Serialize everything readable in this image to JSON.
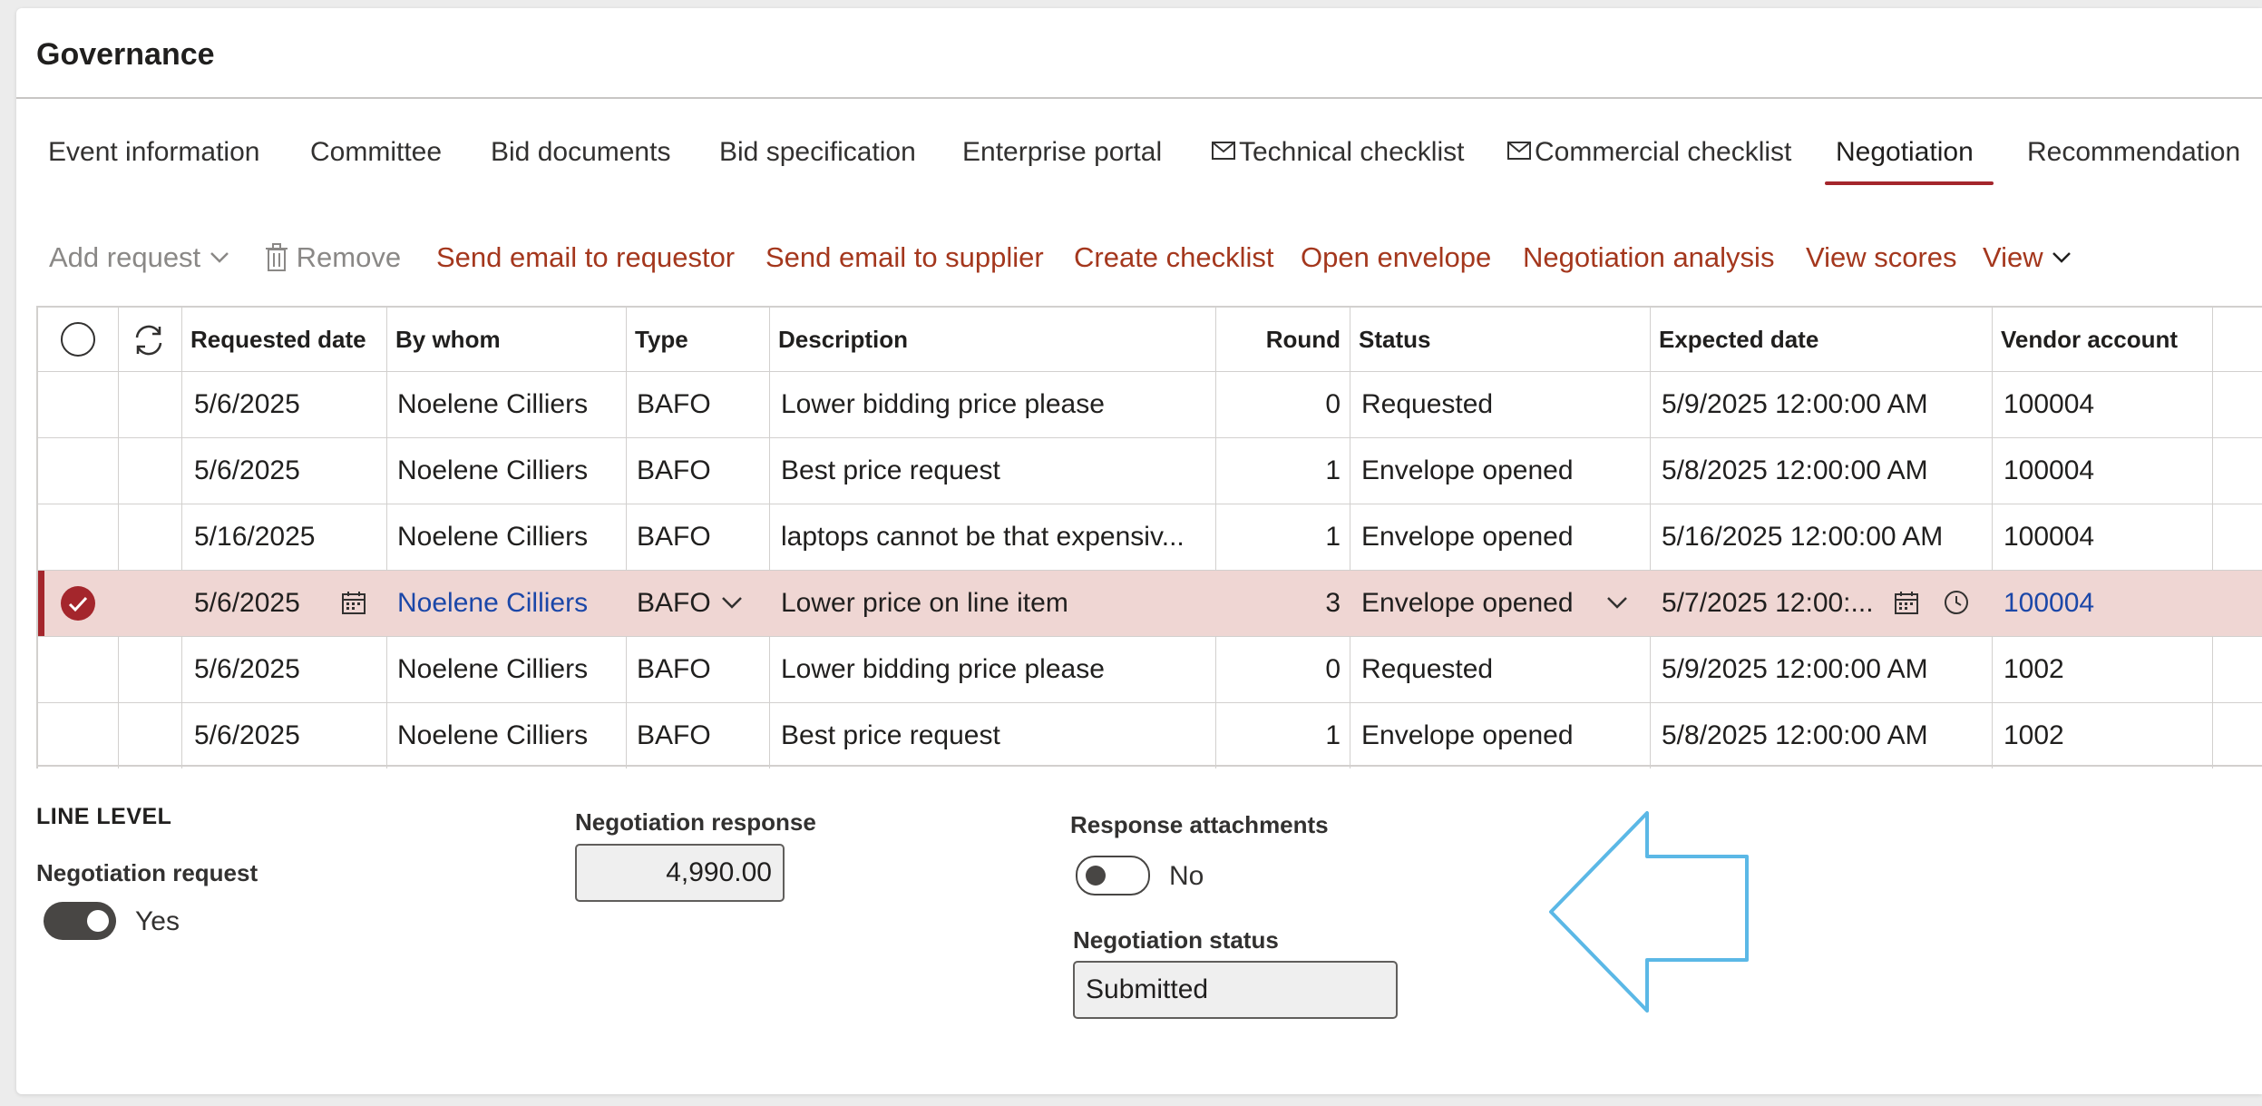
{
  "page": {
    "title": "Governance"
  },
  "tabs": [
    {
      "label": "Event information",
      "icon": ""
    },
    {
      "label": "Committee",
      "icon": ""
    },
    {
      "label": "Bid documents",
      "icon": ""
    },
    {
      "label": "Bid specification",
      "icon": ""
    },
    {
      "label": "Enterprise portal",
      "icon": ""
    },
    {
      "label": "Technical checklist",
      "icon": "mail-icon"
    },
    {
      "label": "Commercial checklist",
      "icon": "mail-icon"
    },
    {
      "label": "Negotiation",
      "icon": "",
      "active": true
    },
    {
      "label": "Recommendation",
      "icon": ""
    }
  ],
  "actions": {
    "add_request": "Add request",
    "remove": "Remove",
    "send_email_requestor": "Send email to requestor",
    "send_email_supplier": "Send email to supplier",
    "create_checklist": "Create checklist",
    "open_envelope": "Open envelope",
    "negotiation_analysis": "Negotiation analysis",
    "view_scores": "View scores",
    "view": "View"
  },
  "grid": {
    "columns": {
      "requested_date": "Requested date",
      "by_whom": "By whom",
      "type": "Type",
      "description": "Description",
      "round": "Round",
      "status": "Status",
      "expected_date": "Expected date",
      "vendor_account": "Vendor account"
    },
    "rows": [
      {
        "requested_date": "5/6/2025",
        "by_whom": "Noelene Cilliers",
        "type": "BAFO",
        "description": "Lower bidding price please",
        "round": "0",
        "status": "Requested",
        "expected_date": "5/9/2025 12:00:00 AM",
        "vendor_account": "100004"
      },
      {
        "requested_date": "5/6/2025",
        "by_whom": "Noelene Cilliers",
        "type": "BAFO",
        "description": "Best price request",
        "round": "1",
        "status": "Envelope opened",
        "expected_date": "5/8/2025 12:00:00 AM",
        "vendor_account": "100004"
      },
      {
        "requested_date": "5/16/2025",
        "by_whom": "Noelene Cilliers",
        "type": "BAFO",
        "description": "laptops cannot be that expensiv...",
        "round": "1",
        "status": "Envelope opened",
        "expected_date": "5/16/2025 12:00:00 AM",
        "vendor_account": "100004"
      },
      {
        "requested_date": "5/6/2025",
        "by_whom": "Noelene Cilliers",
        "type": "BAFO",
        "description": "Lower price on line item",
        "round": "3",
        "status": "Envelope opened",
        "expected_date": "5/7/2025 12:00:...",
        "vendor_account": "100004",
        "selected": true
      },
      {
        "requested_date": "5/6/2025",
        "by_whom": "Noelene Cilliers",
        "type": "BAFO",
        "description": "Lower bidding price please",
        "round": "0",
        "status": "Requested",
        "expected_date": "5/9/2025 12:00:00 AM",
        "vendor_account": "1002"
      },
      {
        "requested_date": "5/6/2025",
        "by_whom": "Noelene Cilliers",
        "type": "BAFO",
        "description": "Best price request",
        "round": "1",
        "status": "Envelope opened",
        "expected_date": "5/8/2025 12:00:00 AM",
        "vendor_account": "1002"
      }
    ]
  },
  "line_level": {
    "heading": "LINE LEVEL",
    "negotiation_request_label": "Negotiation request",
    "negotiation_request_value": "Yes",
    "negotiation_response_label": "Negotiation response",
    "negotiation_response_value": "4,990.00",
    "response_attachments_label": "Response attachments",
    "response_attachments_value": "No",
    "negotiation_status_label": "Negotiation status",
    "negotiation_status_value": "Submitted"
  },
  "colors": {
    "accent": "#a4262c",
    "action_text": "#a4371d",
    "link": "#1b47a8",
    "selected_row": "#efd6d3",
    "annotation_arrow": "#5bb8e6"
  }
}
